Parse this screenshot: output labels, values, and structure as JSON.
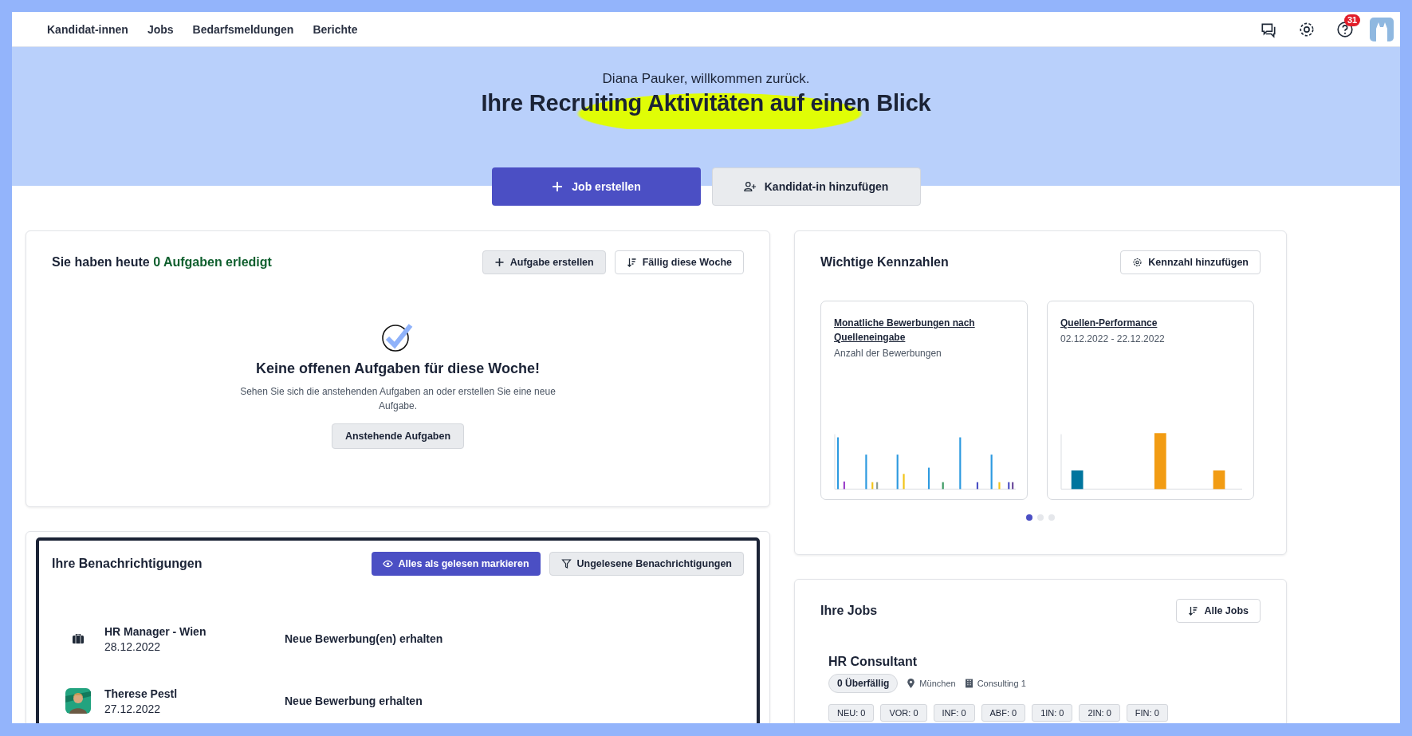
{
  "nav": {
    "links": [
      "Kandidat-innen",
      "Jobs",
      "Bedarfsmeldungen",
      "Berichte"
    ],
    "help_badge": "31"
  },
  "hero": {
    "greeting": "Diana Pauker, willkommen zurück.",
    "title": "Ihre Recruiting Aktivitäten auf einen Blick"
  },
  "actions": [
    {
      "label": "Job erstellen",
      "kind": "primary"
    },
    {
      "label": "Kandidat-in hinzufügen",
      "kind": "secondary"
    }
  ],
  "tasks": {
    "title_prefix": "Sie haben heute",
    "title_highlight": "0 Aufgaben erledigt",
    "buttons": [
      {
        "label": "Aufgabe erstellen",
        "kind": "plus"
      },
      {
        "label": "Fällig diese Woche",
        "kind": "sort"
      }
    ],
    "empty_title": "Keine offenen Aufgaben für diese Woche!",
    "empty_text": "Sehen Sie sich die anstehenden Aufgaben an oder erstellen Sie eine neue Aufgabe.",
    "empty_button": "Anstehende Aufgaben"
  },
  "kpis": {
    "title": "Wichtige Kennzahlen",
    "button": "Kennzahl hinzufügen",
    "cards": [
      {
        "title": "Monatliche Bewerbungen nach Quelleneingabe",
        "subtitle": "Anzahl der Bewerbungen",
        "kind": "thin"
      },
      {
        "title": "Quellen-Performance",
        "subtitle": "02.12.2022 - 22.12.2022",
        "kind": "wide"
      }
    ],
    "pages": [
      {
        "selected": true
      },
      {
        "selected": false
      },
      {
        "selected": false
      }
    ]
  },
  "notifications": {
    "title": "Ihre Benachrichtigungen",
    "buttons": [
      {
        "label": "Alles als gelesen markieren",
        "kind": "primary"
      },
      {
        "label": "Ungelesene Benachrichtigungen",
        "kind": "filter"
      }
    ],
    "items": [
      {
        "kind": "job",
        "name": "HR Manager - Wien",
        "date": "28.12.2022",
        "message": "Neue Bewerbung(en) erhalten"
      },
      {
        "kind": "person",
        "name": "Therese Pestl",
        "date": "27.12.2022",
        "message": "Neue Bewerbung erhalten"
      }
    ]
  },
  "jobs": {
    "title": "Ihre Jobs",
    "button": "Alle Jobs",
    "job": {
      "title": "HR Consultant",
      "overdue": "0 Überfällig",
      "location": "München",
      "company": "Consulting 1",
      "stages": [
        "NEU: 0",
        "VOR: 0",
        "INF: 0",
        "ABF: 0",
        "1IN: 0",
        "2IN: 0",
        "FIN: 0"
      ]
    }
  }
}
